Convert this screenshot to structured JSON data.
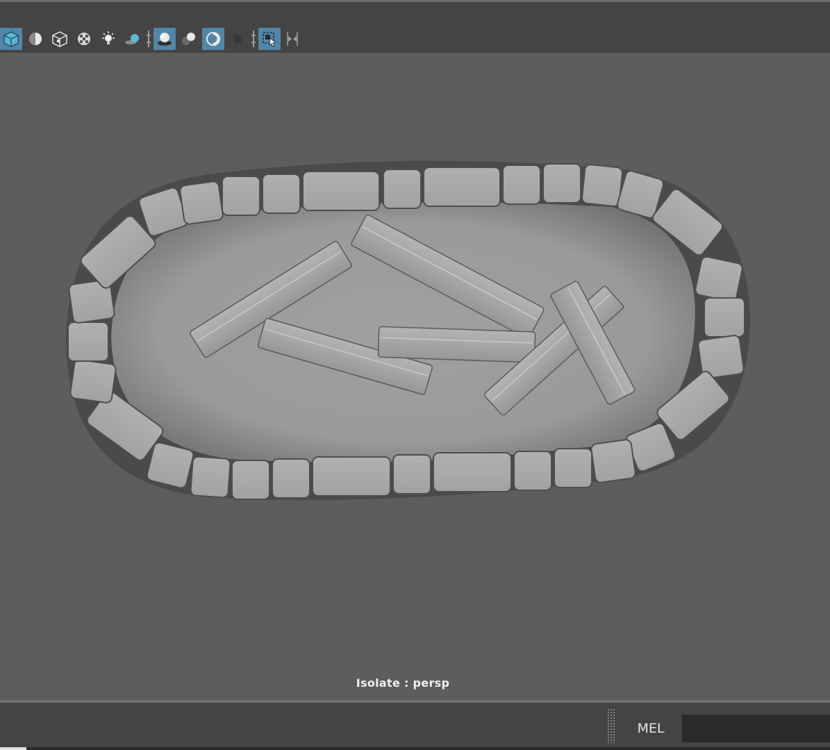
{
  "viewport": {
    "hud_text": "Isolate : persp"
  },
  "toolbar": {
    "buttons": [
      {
        "name": "wireframe-on-shaded-icon",
        "active": true
      },
      {
        "name": "half-sphere-icon",
        "active": false
      },
      {
        "name": "bounding-box-cube-icon",
        "active": false
      },
      {
        "name": "checker-texture-icon",
        "active": false
      },
      {
        "name": "lighting-bulb-icon",
        "active": false
      },
      {
        "name": "shadows-icon",
        "active": false
      },
      {
        "name": "ambient-occlusion-icon",
        "active": true
      },
      {
        "name": "motion-blur-icon",
        "active": false
      },
      {
        "name": "anti-alias-icon",
        "active": true
      },
      {
        "name": "depth-of-field-icon",
        "active": false
      },
      {
        "name": "isolate-select-icon",
        "active": true
      }
    ]
  },
  "command_line": {
    "language_label": "MEL",
    "input_value": ""
  },
  "colors": {
    "viewport_bg": "#5d5d5d",
    "ui_panel": "#444444",
    "active_button": "#5285a6",
    "accent_cyan": "#58b8d8"
  }
}
